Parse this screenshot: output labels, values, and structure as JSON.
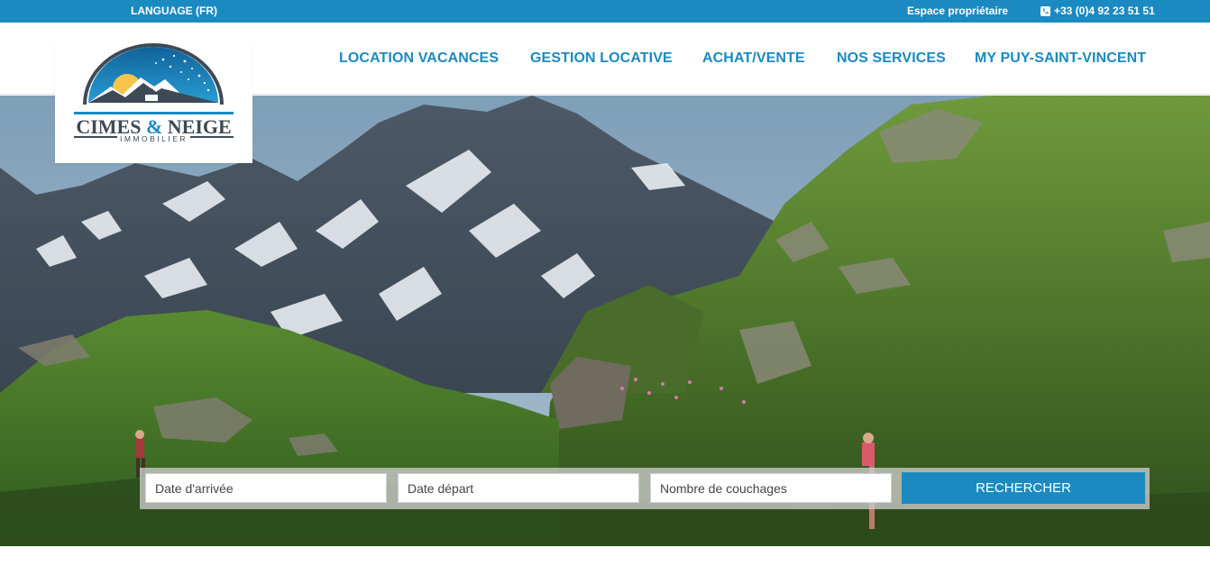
{
  "topbar": {
    "language": "LANGUAGE (FR)",
    "owner_space": "Espace propriétaire",
    "phone": "+33 (0)4 92 23 51 51"
  },
  "nav": [
    {
      "label": "LOCATION VACANCES"
    },
    {
      "label": "GESTION LOCATIVE"
    },
    {
      "label": "ACHAT/VENTE"
    },
    {
      "label": "NOS SERVICES"
    },
    {
      "label": "MY PUY-SAINT-VINCENT"
    }
  ],
  "logo": {
    "line1_a": "CIMES",
    "line1_amp": "&",
    "line1_b": "NEIGE",
    "line2": "IMMOBILIER"
  },
  "search": {
    "arrival_placeholder": "Date d'arrivée",
    "departure_placeholder": "Date départ",
    "beds_placeholder": "Nombre de couchages",
    "button_label": "RECHERCHER"
  },
  "colors": {
    "brand_blue": "#1b8ac0",
    "logo_dark": "#3d4a55"
  },
  "icons": {
    "phone": "phone-icon",
    "hero": "mountain-landscape-image"
  }
}
